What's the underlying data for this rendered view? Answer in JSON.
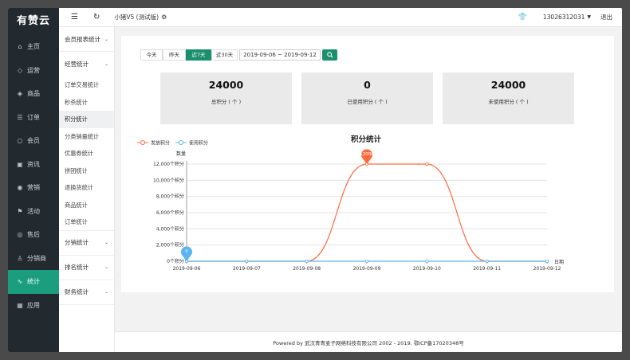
{
  "app": {
    "logo": "有赞云"
  },
  "sidebar": {
    "items": [
      {
        "label": "主页",
        "icon": "house-icon",
        "glyph": "⌂"
      },
      {
        "label": "运营",
        "icon": "shield-check-icon",
        "glyph": "◇"
      },
      {
        "label": "商品",
        "icon": "tag-icon",
        "glyph": "◈"
      },
      {
        "label": "订单",
        "icon": "list-icon",
        "glyph": "☰"
      },
      {
        "label": "会员",
        "icon": "user-icon",
        "glyph": "○"
      },
      {
        "label": "资讯",
        "icon": "news-icon",
        "glyph": "▣"
      },
      {
        "label": "营销",
        "icon": "coin-icon",
        "glyph": "◉"
      },
      {
        "label": "活动",
        "icon": "flag-icon",
        "glyph": "⚑"
      },
      {
        "label": "售后",
        "icon": "service-icon",
        "glyph": "◎"
      },
      {
        "label": "分销商",
        "icon": "person-icon",
        "glyph": "♙"
      },
      {
        "label": "统计",
        "icon": "pulse-icon",
        "glyph": "∿"
      },
      {
        "label": "应用",
        "icon": "grid-icon",
        "glyph": "▦"
      }
    ]
  },
  "topbar": {
    "store_name": "小猪V5 (测试版)",
    "account": "13026312031",
    "logout": "退出"
  },
  "subnav": {
    "report_group": "会员报表统计",
    "ops_group": "经营统计",
    "ops_items": [
      "订单交易统计",
      "秒杀统计",
      "积分统计",
      "分类销量统计",
      "优惠券统计",
      "拼团统计",
      "退换货统计",
      "商品统计",
      "订单统计"
    ],
    "other_groups": [
      "分销统计",
      "排名统计",
      "财务统计"
    ]
  },
  "filters": {
    "ranges": [
      "今天",
      "昨天",
      "近7天",
      "近30天"
    ],
    "date_range": "2019-09-06 ~ 2019-09-12"
  },
  "cards": [
    {
      "value": "24000",
      "label": "总积分 ( 个 )"
    },
    {
      "value": "0",
      "label": "已使用积分 ( 个 )"
    },
    {
      "value": "24000",
      "label": "未使用积分 ( 个 )"
    }
  ],
  "colors": {
    "accent": "#1a9e7e",
    "issued": "#ff6a3d",
    "used": "#5bb4f0"
  },
  "chart_data": {
    "type": "line",
    "title": "积分统计",
    "ylabel": "数量",
    "xlabel": "日期",
    "x": [
      "2019-09-06",
      "2019-09-07",
      "2019-09-08",
      "2019-09-09",
      "2019-09-10",
      "2019-09-11",
      "2019-09-12"
    ],
    "yticks": [
      "0个积分",
      "2,000个积分",
      "4,000个积分",
      "6,000个积分",
      "8,000个积分",
      "10,000个积分",
      "12,000个积分"
    ],
    "ylim": [
      0,
      12000
    ],
    "grid": true,
    "legend": "top-left",
    "series": [
      {
        "name": "发放积分",
        "values": [
          0,
          0,
          0,
          12000,
          12000,
          0,
          0
        ],
        "max_label": "12000",
        "max_index": 3
      },
      {
        "name": "使用积分",
        "values": [
          0,
          0,
          0,
          0,
          0,
          0,
          0
        ],
        "max_label": "0",
        "max_index": 0
      }
    ]
  }
}
